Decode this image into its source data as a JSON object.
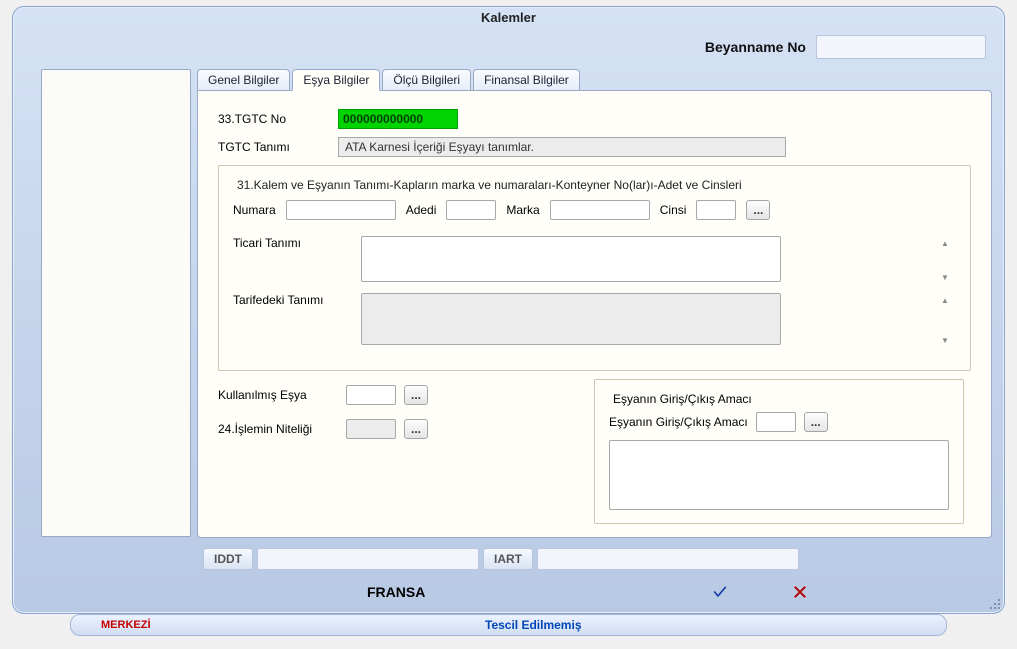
{
  "dialog": {
    "title": "Kalemler"
  },
  "header": {
    "beyanname_label": "Beyanname No",
    "beyanname_value": ""
  },
  "tabs": [
    {
      "label": "Genel Bilgiler",
      "active": false
    },
    {
      "label": "Eşya Bilgiler",
      "active": true
    },
    {
      "label": "Ölçü Bilgileri",
      "active": false
    },
    {
      "label": "Finansal Bilgiler",
      "active": false
    }
  ],
  "fields": {
    "tgtc_no_label": "33.TGTC No",
    "tgtc_no_value": "000000000000",
    "tgtc_tanimi_label": "TGTC Tanımı",
    "tgtc_tanimi_value": "ATA Karnesi İçeriği Eşyayı tanımlar.",
    "group31_title": "31.Kalem ve Eşyanın Tanımı-Kapların marka ve numaraları-Konteyner No(lar)ı-Adet ve Cinsleri",
    "numara_label": "Numara",
    "numara_value": "",
    "adedi_label": "Adedi",
    "adedi_value": "",
    "marka_label": "Marka",
    "marka_value": "",
    "cinsi_label": "Cinsi",
    "cinsi_value": "",
    "lookup_label": "...",
    "ticari_tanimi_label": "Ticari Tanımı",
    "ticari_tanimi_value": "",
    "tarifedeki_tanimi_label": "Tarifedeki Tanımı",
    "tarifedeki_tanimi_value": "",
    "kullanilmis_label": "Kullanılmış Eşya",
    "kullanilmis_value": "",
    "islem_niteligi_label": "24.İşlemin Niteliği",
    "islem_niteligi_value": "",
    "purpose_legend": "Eşyanın Giriş/Çıkış Amacı",
    "purpose_inner_label": "Eşyanın Giriş/Çıkış Amacı",
    "purpose_value": "",
    "purpose_text": ""
  },
  "footer": {
    "iddt_label": "IDDT",
    "iddt_value": "",
    "iart_label": "IART",
    "iart_value": "",
    "country": "FRANSA"
  },
  "statusbar": {
    "left": "MERKEZİ",
    "center": "Tescil Edilmemiş"
  }
}
